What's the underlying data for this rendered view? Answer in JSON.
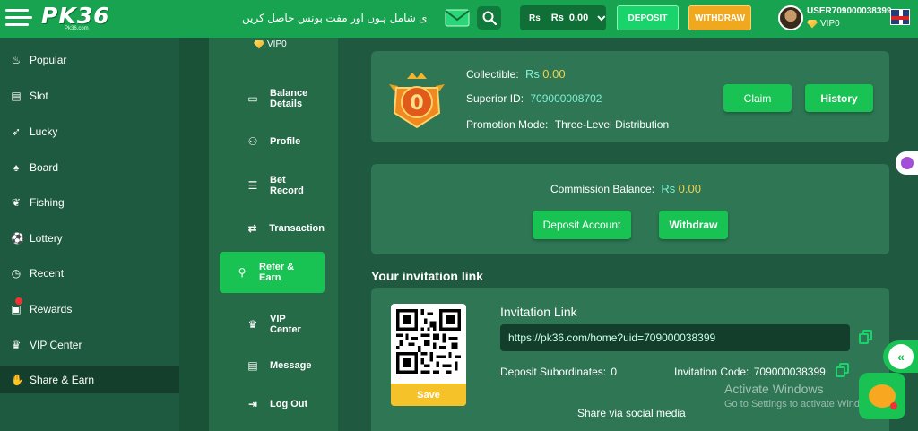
{
  "header": {
    "logo": "PK36",
    "logo_sub": "Pk36.com",
    "marquee": "ی شامل ہوں اور مفت بونس حاصل کریں",
    "balance_currency_small": "Rs",
    "balance_currency": "Rs",
    "balance_value": "0.00",
    "deposit_label": "DEPOSIT",
    "withdraw_label": "WITHDRAW",
    "username": "USER709000038399",
    "vip_level": "VIP0"
  },
  "sidebar": {
    "items": [
      {
        "label": "Popular",
        "icon": "flame-icon"
      },
      {
        "label": "Slot",
        "icon": "slot-icon"
      },
      {
        "label": "Lucky",
        "icon": "rocket-icon"
      },
      {
        "label": "Board",
        "icon": "cards-icon"
      },
      {
        "label": "Fishing",
        "icon": "fish-icon"
      },
      {
        "label": "Lottery",
        "icon": "ball-icon"
      },
      {
        "label": "Recent",
        "icon": "clock-icon"
      },
      {
        "label": "Rewards",
        "icon": "gift-icon"
      },
      {
        "label": "VIP Center",
        "icon": "crown-icon"
      },
      {
        "label": "Share & Earn",
        "icon": "handshake-icon"
      }
    ],
    "active": "Share & Earn"
  },
  "account_menu": {
    "vip": "VIP0",
    "items": [
      {
        "label": "Balance Details",
        "icon": "wallet-icon"
      },
      {
        "label": "Profile",
        "icon": "user-icon"
      },
      {
        "label": "Bet Record",
        "icon": "record-icon"
      },
      {
        "label": "Transaction",
        "icon": "transaction-icon"
      },
      {
        "label": "Refer & Earn",
        "icon": "refer-icon"
      },
      {
        "label": "VIP Center",
        "icon": "crown-icon"
      },
      {
        "label": "Message",
        "icon": "message-icon"
      },
      {
        "label": "Log Out",
        "icon": "logout-icon"
      }
    ],
    "active": "Refer & Earn"
  },
  "summary": {
    "badge_level": "0",
    "collectible_label": "Collectible:",
    "collectible_currency": "Rs",
    "collectible_value": "0.00",
    "superior_label": "Superior ID:",
    "superior_value": "709000008702",
    "promotion_label": "Promotion Mode:",
    "promotion_value": "Three-Level Distribution",
    "claim_label": "Claim",
    "history_label": "History"
  },
  "commission": {
    "label": "Commission Balance:",
    "currency": "Rs",
    "value": "0.00",
    "deposit_account_label": "Deposit Account",
    "withdraw_label": "Withdraw"
  },
  "invitation": {
    "section_title": "Your invitation link",
    "title": "Invitation Link",
    "link": "https://pk36.com/home?uid=709000038399",
    "save_label": "Save",
    "deposit_subordinates_label": "Deposit Subordinates:",
    "deposit_subordinates_value": "0",
    "invitation_code_label": "Invitation Code:",
    "invitation_code_value": "709000038399",
    "share_label": "Share via social media"
  },
  "watermark": {
    "line1": "Activate Windows",
    "line2": "Go to Settings to activate Windows."
  },
  "colors": {
    "primary_green": "#18c354",
    "header_green": "#17a34f",
    "card_bg": "#2e7654",
    "accent_cyan": "#7ff0d4",
    "gold": "#f0d050",
    "withdraw_orange": "#f0a81e"
  }
}
